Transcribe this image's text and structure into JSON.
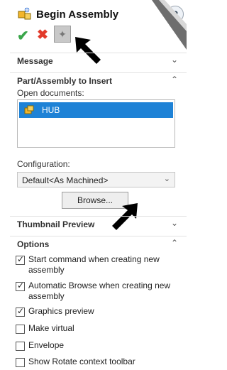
{
  "header": {
    "title": "Begin Assembly",
    "help_label": "?"
  },
  "sections": {
    "message": "Message",
    "part_insert": "Part/Assembly to Insert",
    "thumbnail": "Thumbnail Preview",
    "options": "Options"
  },
  "part_insert": {
    "open_documents_label": "Open documents:",
    "documents": [
      "HUB"
    ],
    "configuration_label": "Configuration:",
    "configuration_value": "Default<As Machined>",
    "browse_label": "Browse..."
  },
  "options": [
    {
      "label": "Start command when creating new assembly",
      "checked": true
    },
    {
      "label": "Automatic Browse when creating new assembly",
      "checked": true
    },
    {
      "label": "Graphics preview",
      "checked": true
    },
    {
      "label": "Make virtual",
      "checked": false
    },
    {
      "label": "Envelope",
      "checked": false
    },
    {
      "label": "Show Rotate context toolbar",
      "checked": false
    }
  ],
  "icons": {
    "ok": "checkmark-icon",
    "cancel": "close-icon",
    "pin": "pushpin-icon",
    "help": "help-icon"
  },
  "colors": {
    "selection": "#1e82d6",
    "ok": "#3aa64a",
    "cancel": "#e23a2a"
  }
}
